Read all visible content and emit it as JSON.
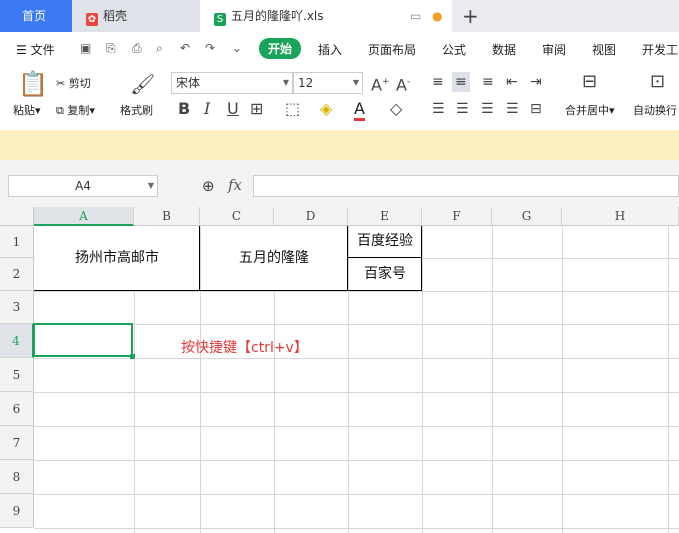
{
  "tabs": {
    "home": "首页",
    "daoke": "稻壳",
    "file": "五月的隆隆吖.xls",
    "add": "+"
  },
  "menu": {
    "file": "文件",
    "items": [
      "开始",
      "插入",
      "页面布局",
      "公式",
      "数据",
      "审阅",
      "视图",
      "开发工"
    ]
  },
  "ribbon": {
    "paste": "粘贴",
    "cut": "剪切",
    "copy": "复制",
    "format_painter": "格式刷",
    "font_name": "宋体",
    "font_size": "12",
    "merge_center": "合并居中",
    "auto_wrap": "自动换行"
  },
  "formula_bar": {
    "name_box": "A4",
    "fx": "fx",
    "value": ""
  },
  "sheet": {
    "columns": [
      "A",
      "B",
      "C",
      "D",
      "E",
      "F",
      "G",
      "H"
    ],
    "rows": [
      "1",
      "2",
      "3",
      "4",
      "5",
      "6",
      "7",
      "8",
      "9"
    ],
    "cells": {
      "a1": "扬州市高邮市",
      "c1": "五月的隆隆",
      "e1": "百度经验",
      "e2": "百家号"
    },
    "annotation": "按快捷键【ctrl+v】",
    "annotation_color": "#e53935",
    "selected_cell": "A4"
  },
  "colors": {
    "accent": "#3c79f2",
    "start_tab": "#1aa35a",
    "selection": "#1aa35a"
  }
}
